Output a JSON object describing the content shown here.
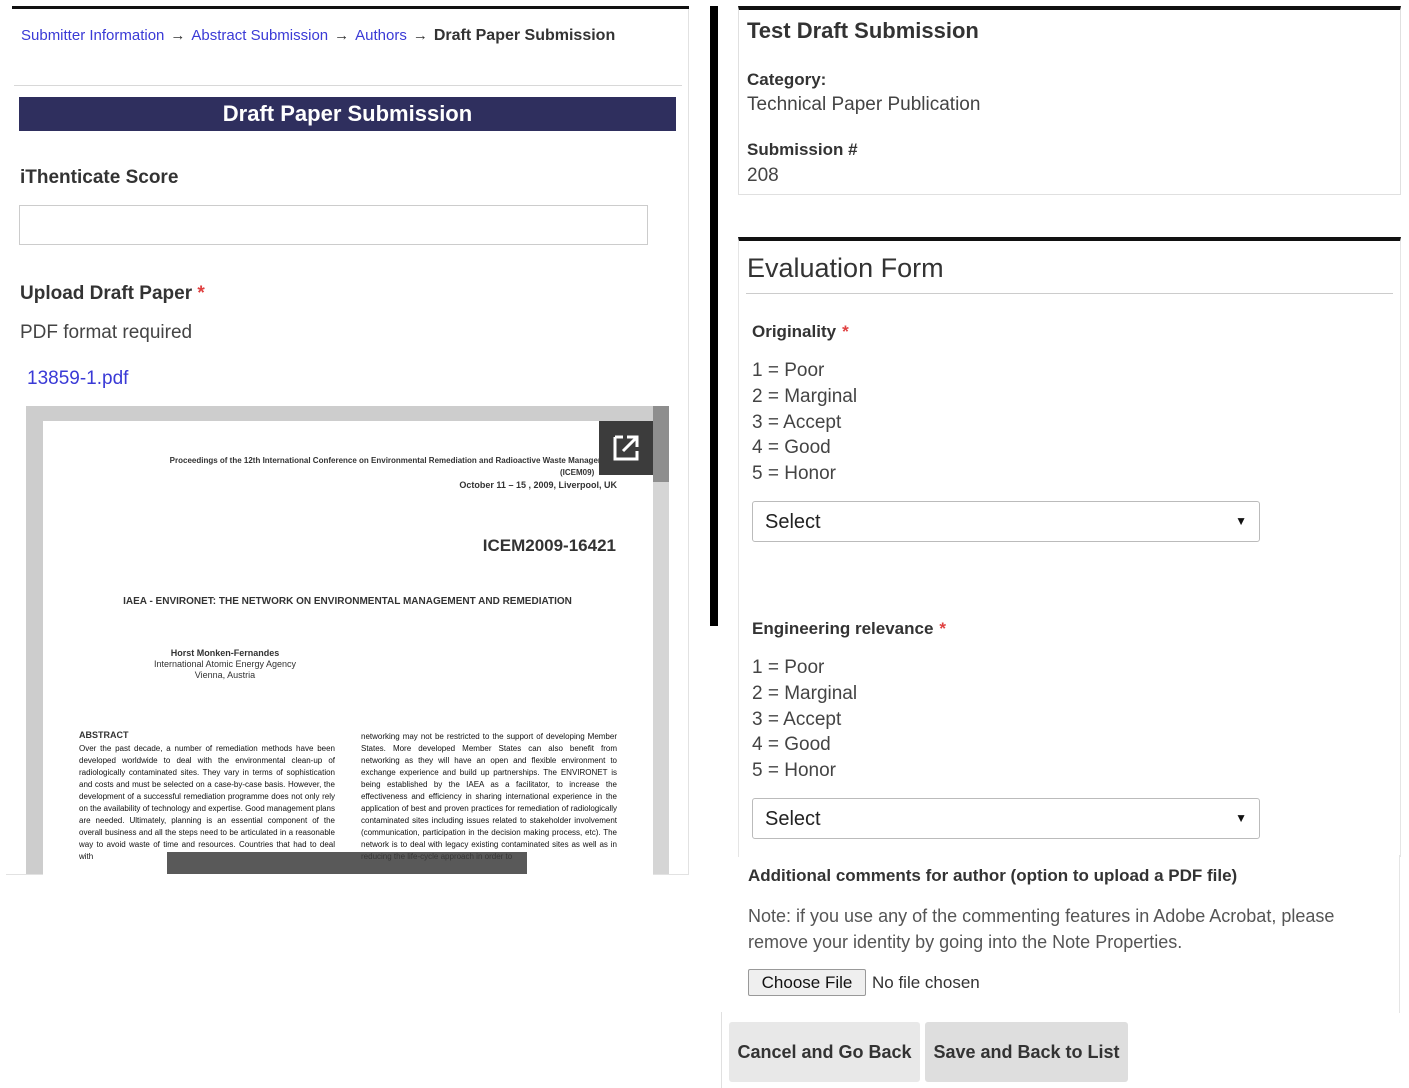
{
  "breadcrumb": {
    "items": [
      "Submitter Information",
      "Abstract Submission",
      "Authors"
    ],
    "sep": "→",
    "current": "Draft Paper Submission"
  },
  "left": {
    "header": "Draft Paper Submission",
    "ithenticate_label": "iThenticate Score",
    "ithenticate_value": "",
    "upload_label": "Upload Draft Paper",
    "required_mark": "*",
    "pdf_required": "PDF format required",
    "file_link": "13859-1.pdf"
  },
  "pdf_page": {
    "proceedings": "Proceedings of the 12th International Conference on Environmental Remediation and Radioactive Waste Management",
    "icem_small": "(ICEM09)",
    "dates": "October 11 – 15 , 2009, Liverpool, UK",
    "code": "ICEM2009-16421",
    "title": "IAEA - ENVIRONET: THE NETWORK ON ENVIRONMENTAL MANAGEMENT AND REMEDIATION",
    "author_name": "Horst Monken-Fernandes",
    "author_org": "International Atomic Energy Agency",
    "author_loc": "Vienna, Austria",
    "abstract_heading": "ABSTRACT",
    "col1": "Over the past decade, a number of remediation methods have been developed worldwide to deal with the environmental clean-up of radiologically contaminated sites. They vary in terms of sophistication and costs and must be selected on a case-by-case basis. However, the development of a successful remediation programme does not only rely on the availability of technology and expertise. Good management plans are needed. Ultimately, planning is an essential component of the overall business and all the steps need to be articulated in a reasonable way to avoid waste of time and resources. Countries that had to deal with",
    "col2": "networking may not be restricted to the support of developing Member States. More developed Member States can also benefit from networking as they will have an open and flexible environment to exchange experience and build up partnerships. The ENVIRONET is being established by the IAEA as a facilitator, to increase the effectiveness and efficiency in sharing international experience in the application of best and proven practices for remediation of radiologically contaminated sites including issues related to stakeholder involvement (communication, participation in the decision making process, etc). The network is to deal with legacy existing contaminated sites as well as in reducing the life-cycle approach in order to"
  },
  "info": {
    "title": "Test Draft Submission",
    "category_label": "Category:",
    "category_value": "Technical Paper Publication",
    "submission_label": "Submission #",
    "submission_value": "208"
  },
  "eval": {
    "title": "Evaluation Form",
    "questions": [
      {
        "label": "Originality",
        "required": "*",
        "scale": [
          "1 = Poor",
          "2 = Marginal",
          "3 = Accept",
          "4 = Good",
          "5 = Honor"
        ],
        "selected": "Select"
      },
      {
        "label": "Engineering relevance",
        "required": "*",
        "scale": [
          "1 = Poor",
          "2 = Marginal",
          "3 = Accept",
          "4 = Good",
          "5 = Honor"
        ],
        "selected": "Select"
      }
    ],
    "comments_label": "Additional comments for author (option to upload a PDF file)",
    "note": "Note: if you use any of the commenting features in Adobe Acrobat, please remove your identity by going into the Note Properties.",
    "choose_file": "Choose File",
    "no_file": "No file chosen"
  },
  "footer": {
    "cancel": "Cancel and Go Back",
    "save": "Save and Back to List"
  },
  "icons": {
    "popout": "open-in-new-icon",
    "dropdown": "dropdown-arrow-icon"
  },
  "colors": {
    "header_bg": "#2f2f5e",
    "link": "#3a3ad6",
    "required": "#e04040"
  }
}
